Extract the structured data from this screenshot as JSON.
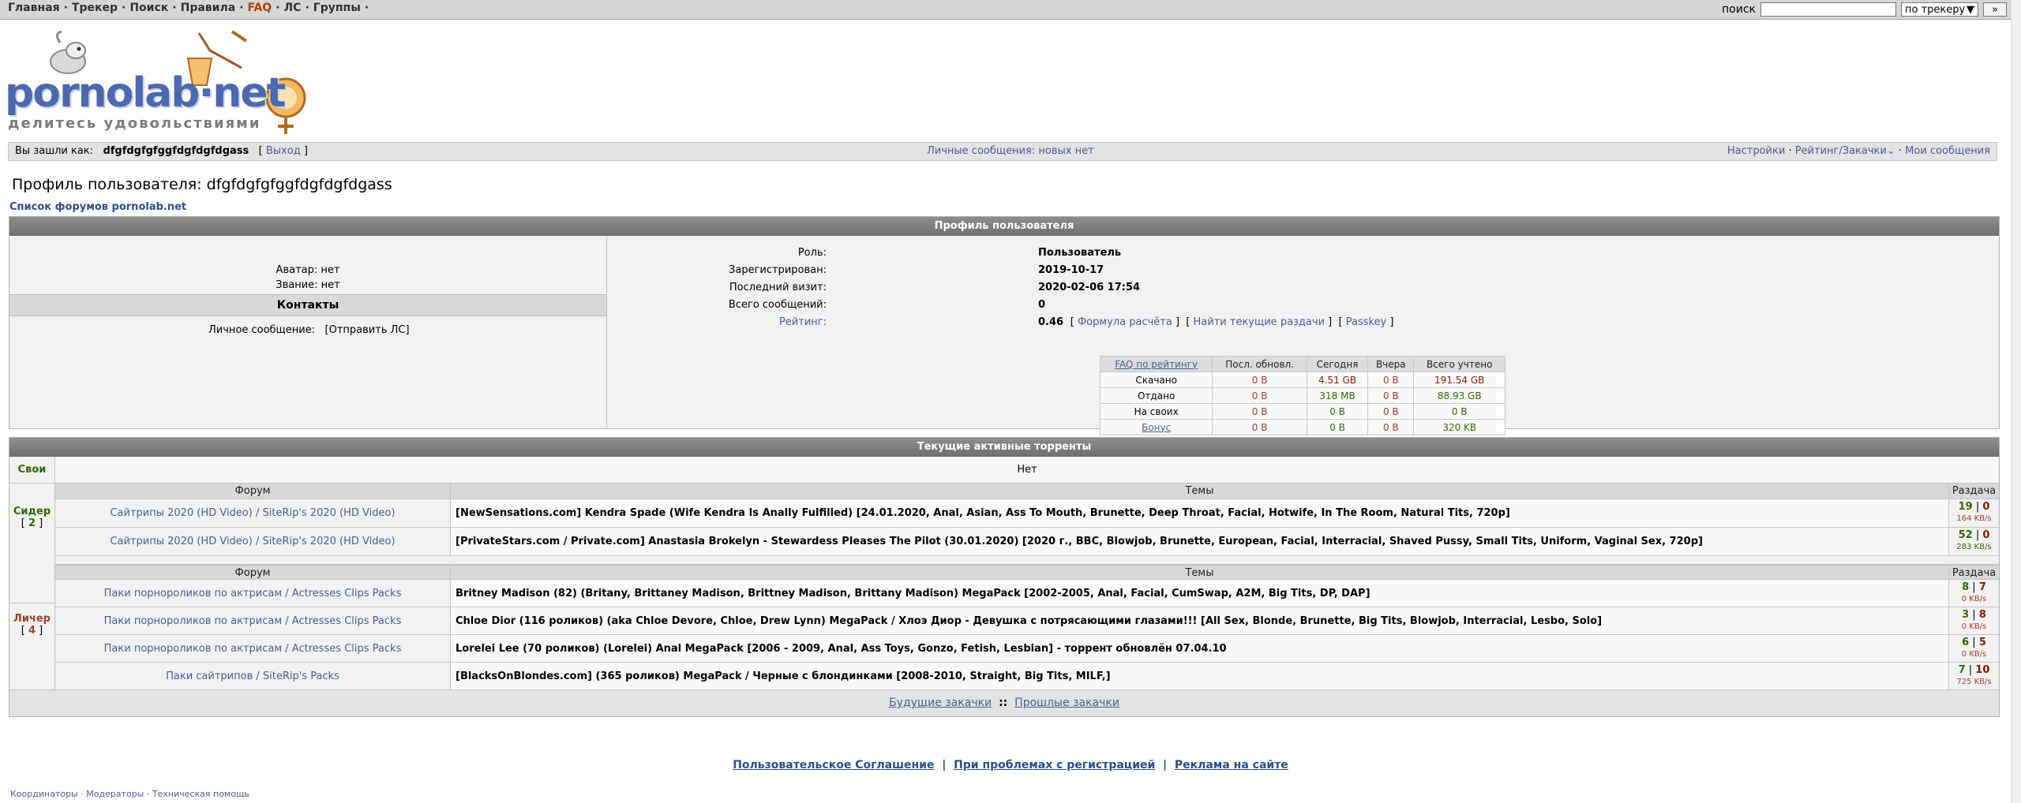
{
  "topnav": {
    "items": [
      "Главная",
      "Трекер",
      "Поиск",
      "Правила",
      "FAQ",
      "ЛС",
      "Группы"
    ],
    "search_label": "поиск",
    "search_value": "",
    "search_scope": "по трекеру",
    "search_go": "»"
  },
  "logo": {
    "text": "pornolab·net",
    "tagline": "делитесь удовольствиями"
  },
  "loginbar": {
    "logged_as_label": "Вы зашли как:",
    "username": "dfgfdgfgfggfdgfdgfdgass",
    "logout": "Выход",
    "pm_status": "Личные сообщения: новых нет",
    "settings": "Настройки",
    "rating": "Рейтинг/Закачки",
    "my_posts": "Мои сообщения"
  },
  "page": {
    "title": "Профиль пользователя: dfgfdgfgfggfdgfdgfdgass",
    "forums_link": "Список форумов pornolab.net"
  },
  "profile": {
    "header": "Профиль пользователя",
    "avatar": "Аватар: нет",
    "rank": "Звание: нет",
    "contacts_header": "Контакты",
    "pm_label": "Личное сообщение:",
    "pm_action": "[Отправить ЛС]",
    "fields": {
      "role_label": "Роль:",
      "role": "Пользователь",
      "registered_label": "Зарегистрирован:",
      "registered": "2019-10-17",
      "last_visit_label": "Последний визит:",
      "last_visit": "2020-02-06 17:54",
      "posts_label": "Всего сообщений:",
      "posts": "0",
      "rating_label": "Рейтинг:",
      "rating": "0.46",
      "formula": "Формула расчёта",
      "find_torrents": "Найти текущие раздачи",
      "passkey": "Passkey"
    },
    "stats": {
      "headers": [
        "FAQ по рейтингу",
        "Посл. обновл.",
        "Сегодня",
        "Вчера",
        "Всего учтено"
      ],
      "rows": [
        {
          "label": "Скачано",
          "last": "0 B",
          "today": "4.51 GB",
          "yesterday": "0 B",
          "total": "191.54 GB"
        },
        {
          "label": "Отдано",
          "last": "0 B",
          "today": "318 MB",
          "yesterday": "0 B",
          "total": "88.93 GB"
        },
        {
          "label": "На своих",
          "last": "0 B",
          "today": "0 B",
          "yesterday": "0 B",
          "total": "0 B"
        },
        {
          "label": "Бонус",
          "last": "0 B",
          "today": "0 B",
          "yesterday": "0 B",
          "total": "320 KB"
        }
      ]
    }
  },
  "torrents": {
    "header": "Текущие активные торренты",
    "own_label": "Свои",
    "own_value": "Нет",
    "col_forum": "Форум",
    "col_topics": "Темы",
    "col_seed": "Раздача",
    "seeder_label": "Сидер",
    "seeder_count": "2",
    "leecher_label": "Личер",
    "leecher_count": "4",
    "seeding": [
      {
        "forum": "Сайтрипы 2020 (HD Video) / SiteRip's 2020 (HD Video)",
        "topic": "[NewSensations.com] Kendra Spade (Wife Kendra Is Anally Fulfilled) [24.01.2020, Anal, Asian, Ass To Mouth, Brunette, Deep Throat, Facial, Hotwife, In The Room, Natural Tits, 720p]",
        "seeds": "19",
        "leech": "0",
        "speed": "164 KB/s"
      },
      {
        "forum": "Сайтрипы 2020 (HD Video) / SiteRip's 2020 (HD Video)",
        "topic": "[PrivateStars.com / Private.com] Anastasia Brokelyn - Stewardess Pleases The Pilot (30.01.2020) [2020 г., BBC, Blowjob, Brunette, European, Facial, Interracial, Shaved Pussy, Small Tits, Uniform, Vaginal Sex, 720p]",
        "seeds": "52",
        "leech": "0",
        "speed": "283 KB/s"
      }
    ],
    "leeching": [
      {
        "forum": "Паки порнороликов по актрисам / Actresses Clips Packs",
        "topic": "Britney Madison (82) (Britany, Brittaney Madison, Brittney Madison, Brittany Madison) MegaPack [2002-2005, Anal, Facial, CumSwap, A2M, Big Tits, DP, DAP]",
        "seeds": "8",
        "leech": "7",
        "speed": "0 KB/s"
      },
      {
        "forum": "Паки порнороликов по актрисам / Actresses Clips Packs",
        "topic": "Chloe Dior (116 роликов) (aka Chloe Devore, Chloe, Drew Lynn) MegaPack / Хлоэ Диор - Девушка с потрясающими глазами!!! [All Sex, Blonde, Brunette, Big Tits, Blowjob, Interracial, Lesbo, Solo]",
        "seeds": "3",
        "leech": "8",
        "speed": "0 KB/s"
      },
      {
        "forum": "Паки порнороликов по актрисам / Actresses Clips Packs",
        "topic": "Lorelei Lee (70 роликов) (Lorelei) Anal MegaPack [2006 - 2009, Anal, Ass Toys, Gonzo, Fetish, Lesbian] - торрент обновлён 07.04.10",
        "seeds": "6",
        "leech": "5",
        "speed": "0 KB/s"
      },
      {
        "forum": "Паки сайтрипов / SiteRip's Packs",
        "topic": "[BlacksOnBlondes.com] (365 роликов) MegaPack / Черные с блондинками [2008-2010, Straight, Big Tits, MILF,]",
        "seeds": "7",
        "leech": "10",
        "speed": "725 KB/s"
      }
    ],
    "future": "Будущие закачки",
    "past": "Прошлые закачки",
    "footer_sep": "::"
  },
  "footer": {
    "agreement": "Пользовательское Соглашение",
    "registration": "При проблемах с регистрацией",
    "ads": "Реклама на сайте",
    "bottom": "Координаторы · Модераторы · Техническая помощь"
  }
}
